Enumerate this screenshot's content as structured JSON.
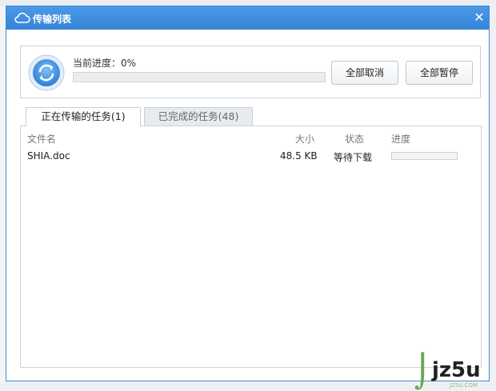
{
  "window": {
    "title": "传输列表"
  },
  "progress": {
    "label": "当前进度：0%",
    "fraction": 0,
    "cancel_all_label": "全部取消",
    "pause_all_label": "全部暂停"
  },
  "tabs": [
    {
      "label": "正在传输的任务(1)",
      "active": true
    },
    {
      "label": "已完成的任务(48)",
      "active": false
    }
  ],
  "table": {
    "headers": {
      "name": "文件名",
      "size": "大小",
      "status": "状态",
      "progress": "进度"
    },
    "rows": [
      {
        "name": "SHIA.doc",
        "size": "48.5 KB",
        "status": "等待下载",
        "progress": 0
      }
    ]
  },
  "watermark": {
    "brand": "jz5u",
    "sub": "JZ5U.COM"
  },
  "colors": {
    "title_bar": "#3684d6",
    "accent": "#3f88d8",
    "watermark_green": "#6aa84f"
  }
}
